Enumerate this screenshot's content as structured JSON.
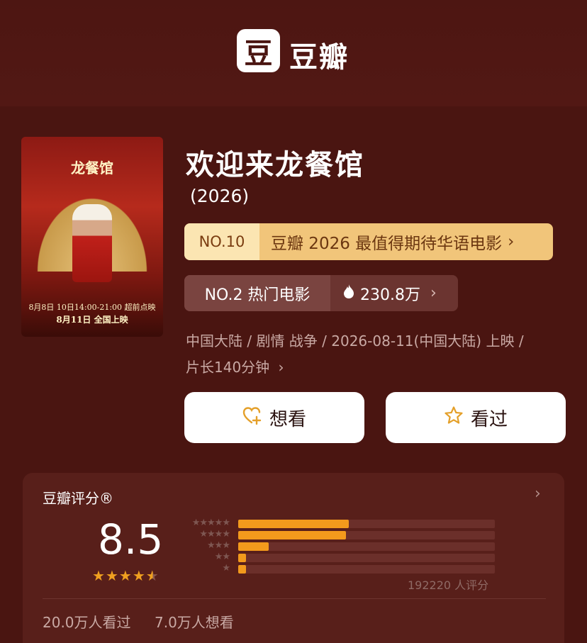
{
  "app": {
    "logo_glyph": "豆",
    "name": "豆瓣"
  },
  "poster": {
    "title_text": "龙餐馆",
    "date_line": "8月8日 10日14:00-21:00 超前点映",
    "release_line": "8月11日 全国上映"
  },
  "movie": {
    "title": "欢迎来龙餐馆",
    "year": "(2026)",
    "meta_line1": "中国大陆 / 剧情 战争 / 2026-08-11(中国大陆) 上映 /",
    "meta_line2": "片长140分钟"
  },
  "rank_list": {
    "no": "NO.10",
    "label": "豆瓣 2026 最值得期待华语电影"
  },
  "rank_hot": {
    "no": "NO.2 热门电影",
    "heat": "230.8万"
  },
  "buttons": {
    "want": "想看",
    "seen": "看过"
  },
  "rating": {
    "header": "豆瓣评分®",
    "score": "8.5",
    "stars": 4.5,
    "count": "192220 人评分",
    "distribution": [
      {
        "stars": 5,
        "fraction": 0.43
      },
      {
        "stars": 4,
        "fraction": 0.42
      },
      {
        "stars": 3,
        "fraction": 0.12
      },
      {
        "stars": 2,
        "fraction": 0.03
      },
      {
        "stars": 1,
        "fraction": 0.03
      }
    ],
    "seen_count": "20.0万人看过",
    "want_count": "7.0万人想看"
  },
  "colors": {
    "background": "#4a1511",
    "accent": "#f39a1c",
    "rank_gold": "#f1c57a"
  }
}
